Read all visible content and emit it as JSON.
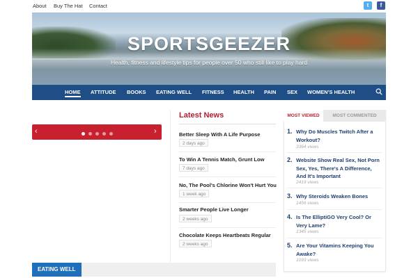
{
  "topnav": [
    "About",
    "Buy The Hat",
    "Contact"
  ],
  "social": {
    "twitter": "t",
    "facebook": "f"
  },
  "header": {
    "title": "SPORTSGEEZER",
    "tagline": "Health, fitness and lifestyle tips for people over 50 who still like to play hard"
  },
  "nav": [
    "HOME",
    "ATTITUDE",
    "BOOKS",
    "EATING WELL",
    "FITNESS",
    "HEALTH",
    "PAIN",
    "SEX",
    "WOMEN'S HEALTH"
  ],
  "slider": {
    "prev": "‹",
    "next": "›",
    "slides": 5,
    "active": 0
  },
  "latest": {
    "heading": "Latest News",
    "items": [
      {
        "title": "Better Sleep With A Life Purpose",
        "date": "2 days ago"
      },
      {
        "title": "To Win A Tennis Match, Grunt Low",
        "date": "7 days ago"
      },
      {
        "title": "No, The Pool's Chlorine Won't Hurt You",
        "date": "1 week ago"
      },
      {
        "title": "Smarter People Live Longer",
        "date": "2 weeks ago"
      },
      {
        "title": "Chocolate Keeps Heartbeats Regular",
        "date": "2 weeks ago"
      }
    ]
  },
  "popular": {
    "tab_viewed": "MOST VIEWED",
    "tab_commented": "MOST COMMENTED",
    "items": [
      {
        "num": "1.",
        "title": "Why Do Muscles Twitch After a Workout?",
        "views": "3364 views"
      },
      {
        "num": "2.",
        "title": "Website Show Real Sex, Not Porn Sex, Yes, There's A Difference, And It's Important",
        "views": "2419 views"
      },
      {
        "num": "3.",
        "title": "Why Steroids Weaken Bones",
        "views": "1456 views"
      },
      {
        "num": "4.",
        "title": "Is The ElliptiGO Very Cool? Or Very Lame?",
        "views": "1345 views"
      },
      {
        "num": "5.",
        "title": "Are Your Vitamins Keeping You Awake?",
        "views": "1093 views"
      }
    ]
  },
  "section": {
    "label": "EATING WELL"
  },
  "colors": {
    "nav_bg": "#1f4e86",
    "accent_red": "#b22030",
    "slider_red": "#c8202f",
    "section_blue": "#1f6fba"
  }
}
